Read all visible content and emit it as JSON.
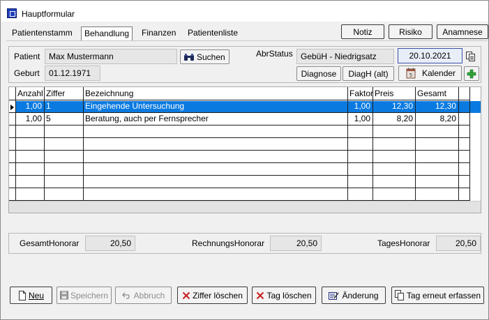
{
  "window": {
    "title": "Hauptformular"
  },
  "tabs": [
    {
      "label": "Patientenstamm"
    },
    {
      "label": "Behandlung"
    },
    {
      "label": "Finanzen"
    },
    {
      "label": "Patientenliste"
    }
  ],
  "top_buttons": {
    "notiz": "Notiz",
    "risiko": "Risiko",
    "anamnese": "Anamnese"
  },
  "patient": {
    "patient_label": "Patient",
    "patient_value": "Max Mustermann",
    "search_label": "Suchen",
    "geburt_label": "Geburt",
    "geburt_value": "01.12.1971",
    "abrstatus_label": "AbrStatus",
    "abrstatus_value": "GebüH - Niedrigsatz",
    "date_value": "20.10.2021",
    "diagnose_label": "Diagnose",
    "diagh_label": "DiagH (alt)",
    "kalender_label": "Kalender"
  },
  "grid": {
    "columns": [
      "Anzahl",
      "Ziffer",
      "Bezeichnung",
      "Faktor",
      "Preis",
      "Gesamt"
    ],
    "rows": [
      {
        "anzahl": "1,00",
        "ziffer": "1",
        "bezeichnung": "Eingehende Untersuchung",
        "faktor": "1,00",
        "preis": "12,30",
        "gesamt": "12,30",
        "selected": true
      },
      {
        "anzahl": "1,00",
        "ziffer": "5",
        "bezeichnung": "Beratung, auch per Fernsprecher",
        "faktor": "1,00",
        "preis": "8,20",
        "gesamt": "8,20",
        "selected": false
      }
    ]
  },
  "totals": {
    "gesamt_label": "GesamtHonorar",
    "gesamt_value": "20,50",
    "rechnung_label": "RechnungsHonorar",
    "rechnung_value": "20,50",
    "tages_label": "TagesHonorar",
    "tages_value": "20,50"
  },
  "bottom_buttons": {
    "neu": "Neu",
    "speichern": "Speichern",
    "abbruch": "Abbruch",
    "ziffer_loeschen": "Ziffer löschen",
    "tag_loeschen": "Tag löschen",
    "aenderung": "Änderung",
    "tag_erneut": "Tag erneut erfassen"
  },
  "colors": {
    "selection": "#0a7ae0",
    "date_border": "#3c50a8",
    "add_icon": "#2fa83a",
    "delete_icon": "#c81e1e",
    "app_icon": "#1f3fb8"
  }
}
